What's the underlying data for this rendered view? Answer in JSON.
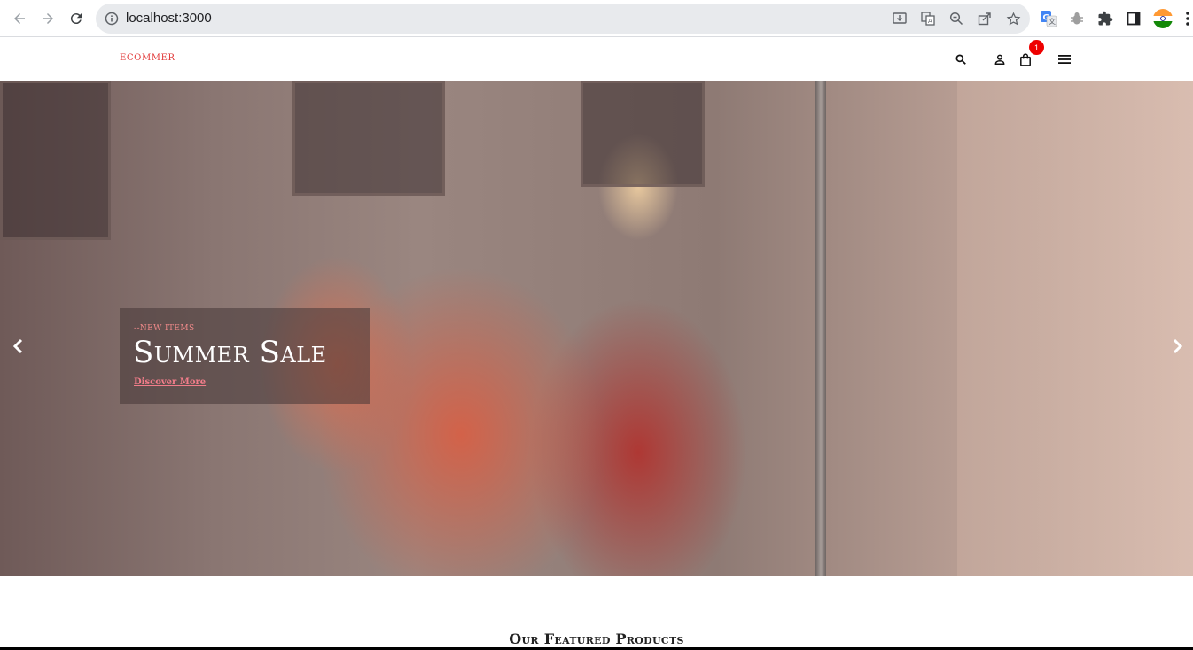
{
  "browser": {
    "url": "localhost:3000",
    "icons": [
      "back-icon",
      "forward-icon",
      "reload-icon",
      "info-icon",
      "install-icon",
      "translate-icon",
      "zoom-icon",
      "share-icon",
      "bookmark-star-icon",
      "google-translate-ext-icon",
      "bug-ext-icon",
      "extensions-puzzle-icon",
      "side-panel-icon",
      "profile-avatar",
      "more-menu-icon"
    ]
  },
  "header": {
    "logo": "ECOMMER",
    "cart_count": "1",
    "icons": [
      "search-icon",
      "user-icon",
      "cart-bag-icon",
      "menu-icon"
    ]
  },
  "hero": {
    "pretitle": "--NEW ITEMS",
    "title": "Summer Sale",
    "link": "Discover More",
    "prev_icon": "chevron-left-icon",
    "next_icon": "chevron-right-icon"
  },
  "featured": {
    "title": "Our Featured Products"
  },
  "colors": {
    "brand": "#e23a3a",
    "badge": "#ee0000",
    "link": "#f27d8a"
  }
}
